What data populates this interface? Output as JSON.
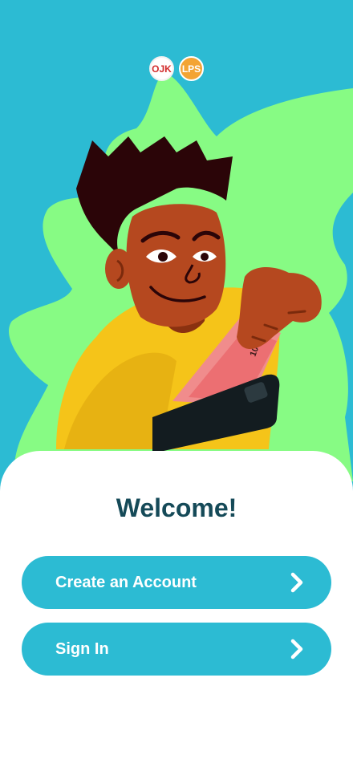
{
  "logos": {
    "ojk": "OJK",
    "lps": "LPS"
  },
  "welcome": {
    "title": "Welcome!"
  },
  "actions": {
    "create_account": "Create an Account",
    "sign_in": "Sign In"
  },
  "colors": {
    "background": "#2cbbd3",
    "blob": "#87fb84",
    "title": "#154a58",
    "button": "#2cbbd3"
  },
  "icons": {
    "chevron": "chevron-right-icon"
  }
}
